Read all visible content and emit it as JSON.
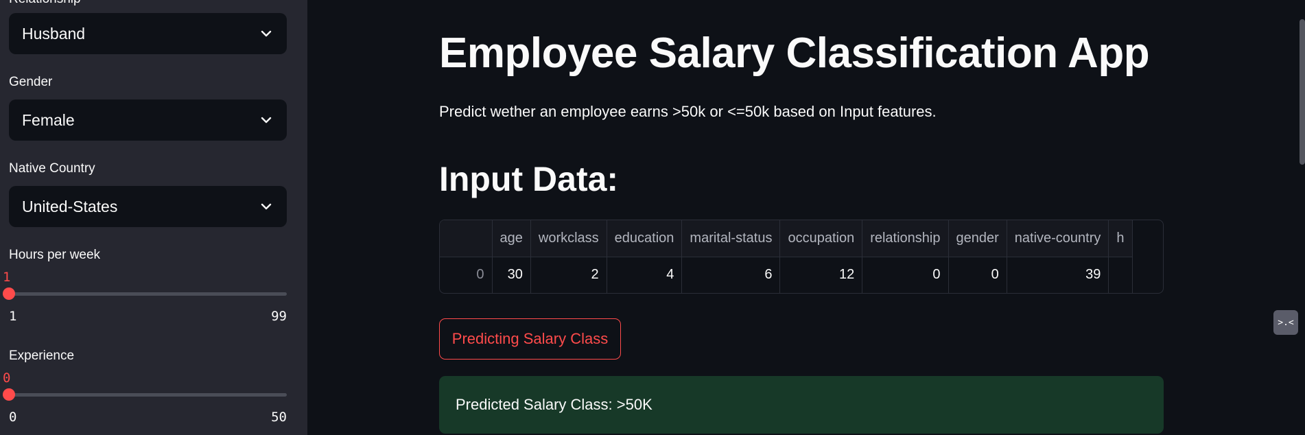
{
  "sidebar": {
    "relationship": {
      "label": "Relationship",
      "value": "Husband"
    },
    "gender": {
      "label": "Gender",
      "value": "Female"
    },
    "native_country": {
      "label": "Native Country",
      "value": "United-States"
    },
    "hours_per_week": {
      "label": "Hours per week",
      "value": "1",
      "min": "1",
      "max": "99",
      "fraction": 0.0
    },
    "experience": {
      "label": "Experience",
      "value": "0",
      "min": "0",
      "max": "50",
      "fraction": 0.0
    }
  },
  "main": {
    "title": "Employee Salary Classification App",
    "subtitle": "Predict wether an employee earns >50k or <=50k based on Input features.",
    "input_heading": "Input Data:",
    "table": {
      "columns": [
        "",
        "age",
        "workclass",
        "education",
        "marital-status",
        "occupation",
        "relationship",
        "gender",
        "native-country",
        "h"
      ],
      "rows": [
        [
          "0",
          "30",
          "2",
          "4",
          "6",
          "12",
          "0",
          "0",
          "39",
          ""
        ]
      ]
    },
    "predict_button": "Predicting Salary Class",
    "result": "Predicted Salary Class: >50K"
  },
  "floating_icon": {
    "glyph": ">.<",
    "icon": "streamlit-status-icon"
  },
  "colors": {
    "accent": "#ff4b4b",
    "sidebar_bg": "#262730",
    "app_bg": "#0e1117",
    "success_bg": "#173928"
  }
}
